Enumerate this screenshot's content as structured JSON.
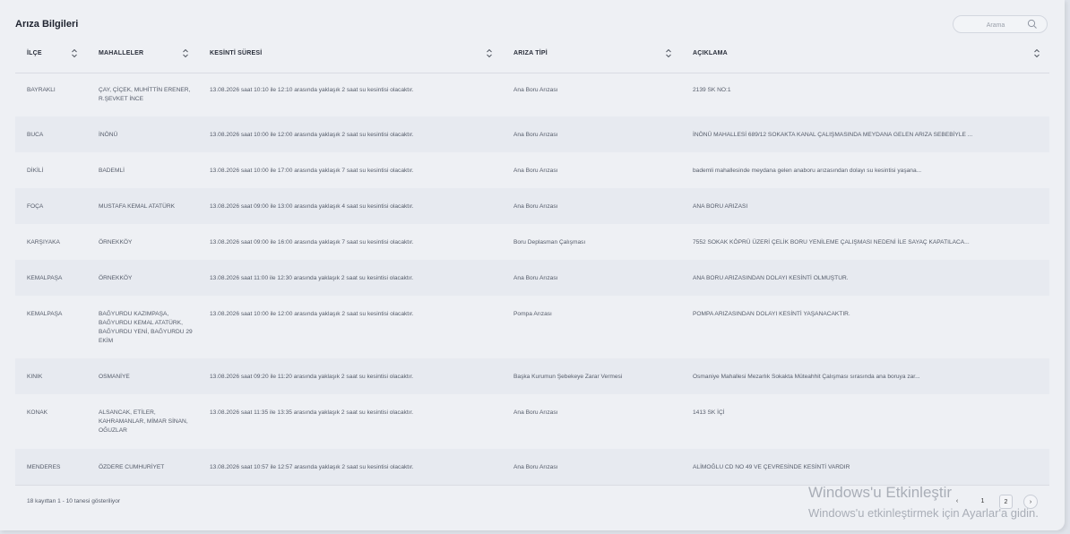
{
  "header": {
    "title": "Arıza Bilgileri",
    "search_placeholder": "Arama"
  },
  "columns": [
    {
      "label": "İLÇE"
    },
    {
      "label": "MAHALLELER"
    },
    {
      "label": "KESİNTİ SÜRESİ"
    },
    {
      "label": "ARIZA TİPİ"
    },
    {
      "label": "AÇIKLAMA"
    }
  ],
  "rows": [
    {
      "ilce": "BAYRAKLI",
      "mahalleler": "ÇAY, ÇİÇEK, MUHİTTİN ERENER, R.ŞEVKET İNCE",
      "kesinti": "13.08.2026 saat 10:10 ile 12:10 arasında yaklaşık 2 saat su kesintisi olacaktır.",
      "tip": "Ana Boru Arızası",
      "aciklama": "2139 SK NO:1"
    },
    {
      "ilce": "BUCA",
      "mahalleler": "İNÖNÜ",
      "kesinti": "13.08.2026 saat 10:00 ile 12:00 arasında yaklaşık 2 saat su kesintisi olacaktır.",
      "tip": "Ana Boru Arızası",
      "aciklama": "İNÖNÜ MAHALLESİ 689/12 SOKAKTA KANAL ÇALIŞMASINDA MEYDANA GELEN ARIZA SEBEBİYLE ..."
    },
    {
      "ilce": "DİKİLİ",
      "mahalleler": "BADEMLİ",
      "kesinti": "13.08.2026 saat 10:00 ile 17:00 arasında yaklaşık 7 saat su kesintisi olacaktır.",
      "tip": "Ana Boru Arızası",
      "aciklama": "bademli mahallesinde meydana gelen anaboru arızasından dolayı su kesintisi yaşana..."
    },
    {
      "ilce": "FOÇA",
      "mahalleler": "MUSTAFA KEMAL ATATÜRK",
      "kesinti": "13.08.2026 saat 09:00 ile 13:00 arasında yaklaşık 4 saat su kesintisi olacaktır.",
      "tip": "Ana Boru Arızası",
      "aciklama": "ANA BORU ARIZASI"
    },
    {
      "ilce": "KARŞIYAKA",
      "mahalleler": "ÖRNEKKÖY",
      "kesinti": "13.08.2026 saat 09:00 ile 16:00 arasında yaklaşık 7 saat su kesintisi olacaktır.",
      "tip": "Boru Deplasman Çalışması",
      "aciklama": "7552 SOKAK KÖPRÜ ÜZERİ ÇELİK BORU YENİLEME ÇALIŞMASI NEDENİ İLE SAYAÇ KAPATILACA..."
    },
    {
      "ilce": "KEMALPAŞA",
      "mahalleler": "ÖRNEKKÖY",
      "kesinti": "13.08.2026 saat 11:00 ile 12:30 arasında yaklaşık 2 saat su kesintisi olacaktır.",
      "tip": "Ana Boru Arızası",
      "aciklama": "ANA BORU ARIZASINDAN DOLAYI KESİNTİ OLMUŞTUR."
    },
    {
      "ilce": "KEMALPAŞA",
      "mahalleler": "BAĞYURDU KAZIMPAŞA, BAĞYURDU KEMAL ATATÜRK, BAĞYURDU YENİ, BAĞYURDU 29 EKİM",
      "kesinti": "13.08.2026 saat 10:00 ile 12:00 arasında yaklaşık 2 saat su kesintisi olacaktır.",
      "tip": "Pompa Arızası",
      "aciklama": "POMPA ARIZASINDAN DOLAYI KESİNTİ YAŞANACAKTIR."
    },
    {
      "ilce": "KINIK",
      "mahalleler": "OSMANİYE",
      "kesinti": "13.08.2026 saat 09:20 ile 11:20 arasında yaklaşık 2 saat su kesintisi olacaktır.",
      "tip": "Başka Kurumun Şebekeye Zarar Vermesi",
      "aciklama": "Osmaniye Mahallesi Mezarlık Sokakta Müteahhit Çalışması sırasında ana boruya zar..."
    },
    {
      "ilce": "KONAK",
      "mahalleler": "ALSANCAK, ETİLER, KAHRAMANLAR, MİMAR SİNAN, OĞUZLAR",
      "kesinti": "13.08.2026 saat 11:35 ile 13:35 arasında yaklaşık 2 saat su kesintisi olacaktır.",
      "tip": "Ana Boru Arızası",
      "aciklama": "1413 SK İÇİ"
    },
    {
      "ilce": "MENDERES",
      "mahalleler": "ÖZDERE CUMHURİYET",
      "kesinti": "13.08.2026 saat 10:57 ile 12:57 arasında yaklaşık 2 saat su kesintisi olacaktır.",
      "tip": "Ana Boru Arızası",
      "aciklama": "ALİMOĞLU CD NO 49 VE ÇEVRESİNDE KESİNTİ VARDIR"
    }
  ],
  "footer": {
    "summary": "18 kayıttan 1 - 10 tanesi gösteriliyor",
    "pages": [
      "1",
      "2"
    ],
    "prev_label": "‹",
    "next_label": "›"
  },
  "watermark": {
    "line1": "Windows'u Etkinleştir",
    "line2": "Windows'u etkinleştirmek için Ayarlar'a gidin."
  },
  "colors": {
    "background": "#eef0f4",
    "alt_row": "#e7eaf0"
  }
}
